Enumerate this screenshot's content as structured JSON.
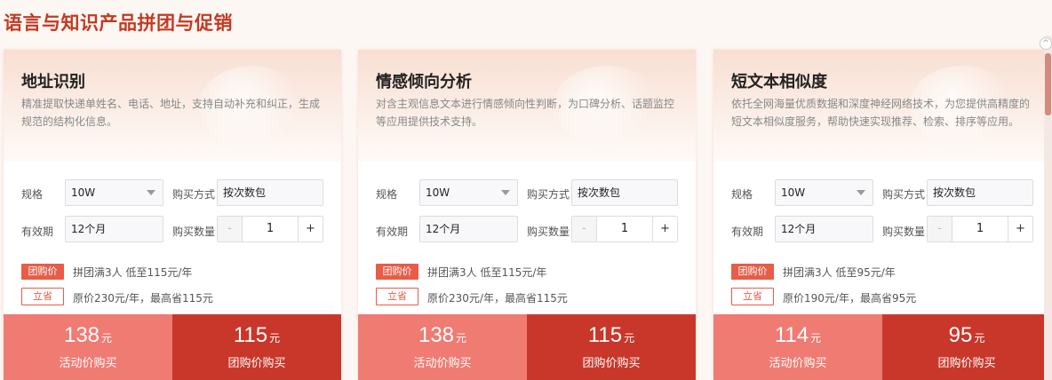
{
  "page": {
    "title": "语言与知识产品拼团与促销"
  },
  "labels": {
    "spec": "规格",
    "purchase_method": "购买方式",
    "validity": "有效期",
    "quantity": "购买数量",
    "group_badge": "团购价",
    "save_badge": "立省",
    "activity_buy": "活动价购买",
    "group_buy": "团购价购买",
    "minus": "-",
    "plus": "+",
    "currency_unit": "元"
  },
  "cards": [
    {
      "title": "地址识别",
      "desc": "精准提取快递单姓名、电话、地址，支持自动补充和纠正，生成规范的结构化信息。",
      "spec": "10W",
      "method": "按次数包",
      "validity": "12个月",
      "quantity": "1",
      "group_text": "拼团满3人 低至115元/年",
      "save_text": "原价230元/年，最高省115元",
      "activity_price": "138",
      "group_price": "115"
    },
    {
      "title": "情感倾向分析",
      "desc": "对含主观信息文本进行情感倾向性判断，为口碑分析、话题监控等应用提供技术支持。",
      "spec": "10W",
      "method": "按次数包",
      "validity": "12个月",
      "quantity": "1",
      "group_text": "拼团满3人 低至115元/年",
      "save_text": "原价230元/年，最高省115元",
      "activity_price": "138",
      "group_price": "115"
    },
    {
      "title": "短文本相似度",
      "desc": "依托全网海量优质数据和深度神经网络技术，为您提供高精度的短文本相似度服务，帮助快速实现推荐、检索、排序等应用。",
      "spec": "10W",
      "method": "按次数包",
      "validity": "12个月",
      "quantity": "1",
      "group_text": "拼团满3人 低至95元/年",
      "save_text": "原价190元/年，最高省95元",
      "activity_price": "114",
      "group_price": "95"
    }
  ],
  "colors": {
    "accent": "#c23a21",
    "activity_button": "#f07b73",
    "group_button": "#c9372a",
    "badge": "#e85c48"
  },
  "icons": {
    "scroll_top": "chevron-up-icon"
  }
}
